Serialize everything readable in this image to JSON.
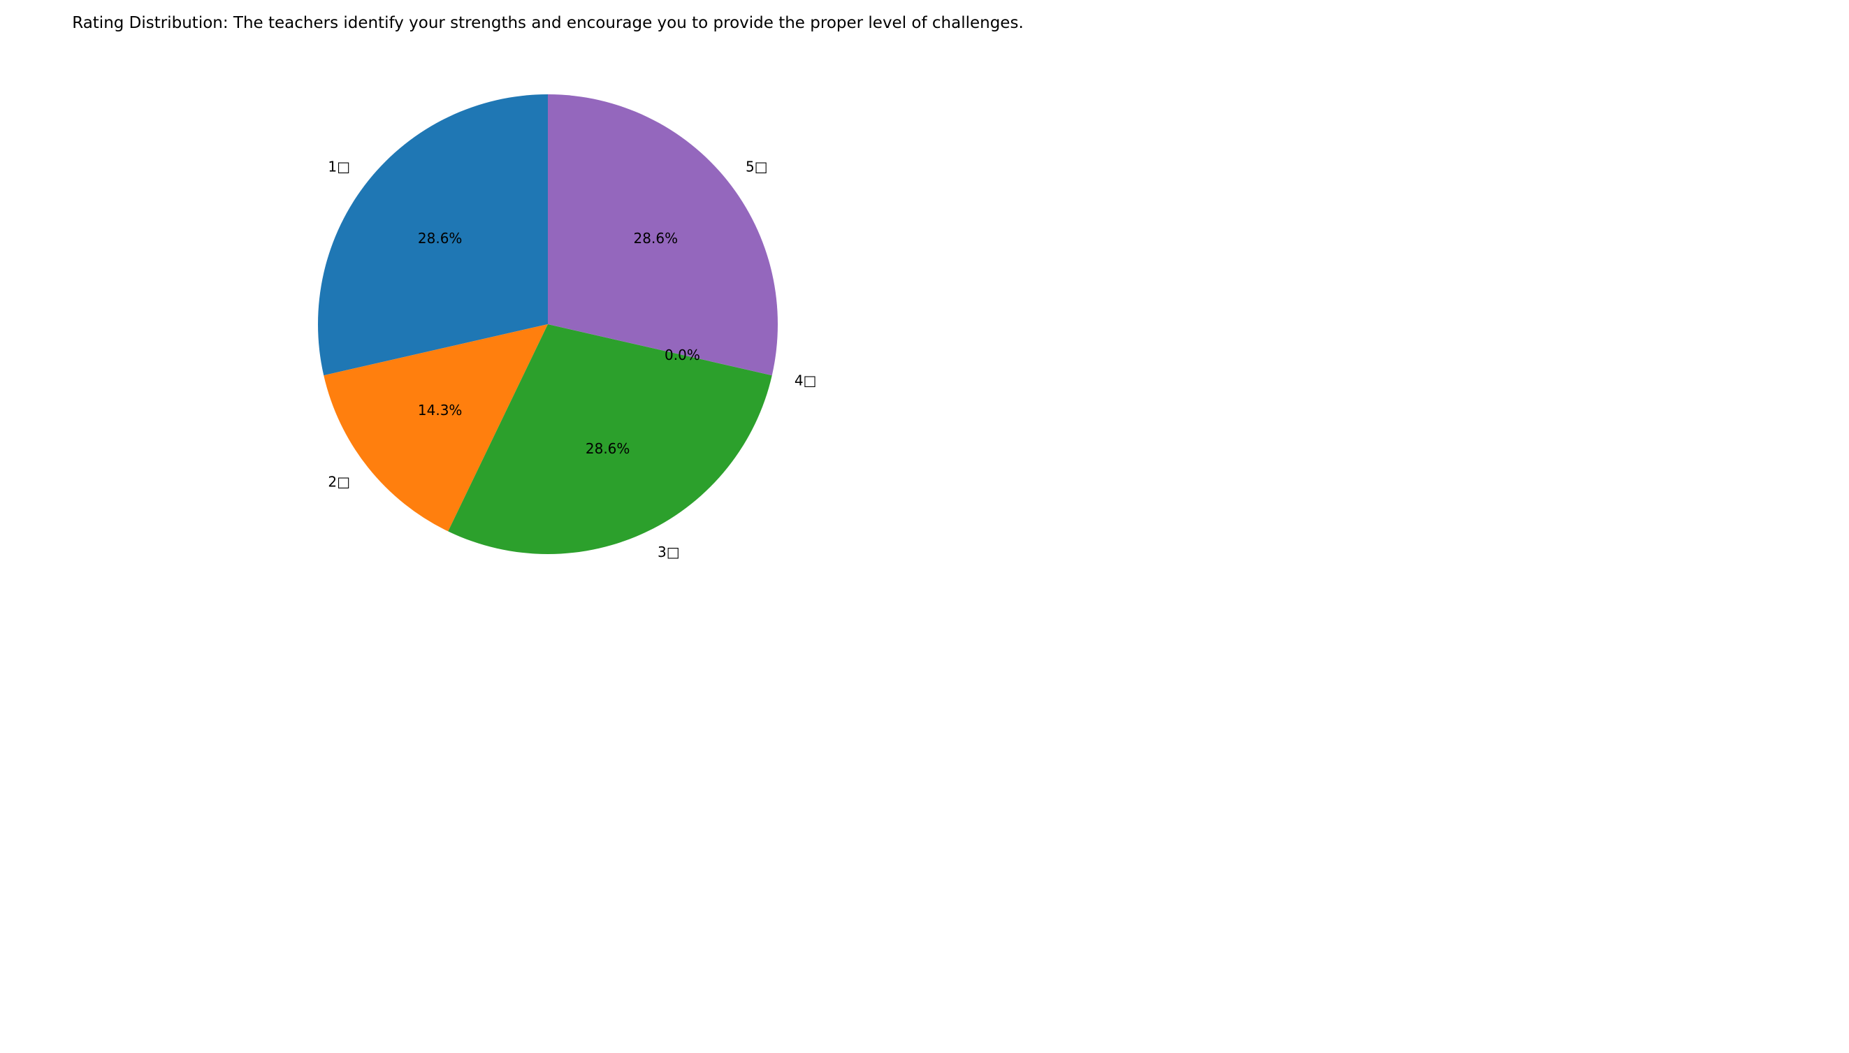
{
  "chart_data": {
    "type": "pie",
    "title": "Rating Distribution: The teachers identify your strengths and encourage you to provide the proper level of challenges.",
    "categories": [
      "1□",
      "2□",
      "3□",
      "4□",
      "5□"
    ],
    "values": [
      28.6,
      14.3,
      28.6,
      0.0,
      28.6
    ],
    "percent_labels": [
      "28.6%",
      "14.3%",
      "28.6%",
      "0.0%",
      "28.6%"
    ],
    "colors": [
      "#1f77b4",
      "#ff7f0e",
      "#2ca02c",
      "#d62728",
      "#9467bd"
    ],
    "start_angle_deg": 90,
    "direction": "counterclockwise",
    "legend": "none"
  }
}
